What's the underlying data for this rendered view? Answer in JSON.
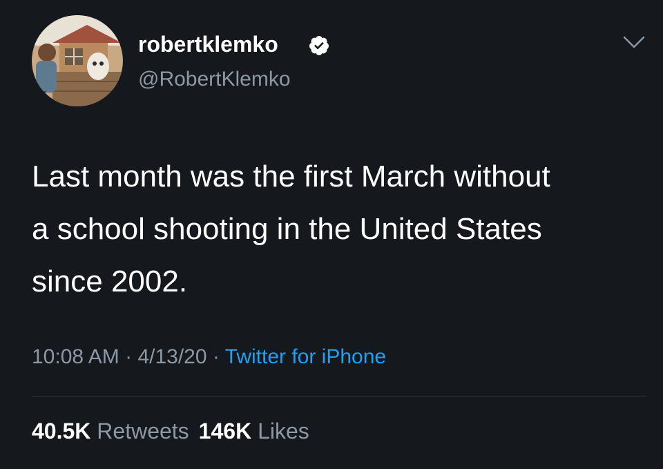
{
  "tweet": {
    "author": {
      "display_name": "robertklemko",
      "handle": "@RobertKlemko",
      "verified": true
    },
    "text": "Last month was the first March without\na school shooting in the United States\nsince 2002.",
    "time": "10:08 AM",
    "separator": " · ",
    "date": "4/13/20",
    "source": "Twitter for iPhone",
    "retweets_count": "40.5K",
    "retweets_label": "Retweets",
    "likes_count": "146K",
    "likes_label": "Likes"
  },
  "colors": {
    "background": "#15181c",
    "text_primary": "#ffffff",
    "text_secondary": "#8b98a5",
    "link": "#1da1f2",
    "divider": "#2f3336"
  },
  "icons": {
    "verified": "verified-badge-icon",
    "menu": "chevron-down-icon"
  }
}
